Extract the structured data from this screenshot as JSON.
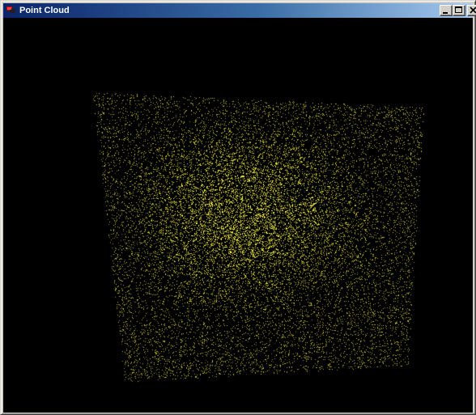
{
  "window": {
    "title": "Point Cloud",
    "icon": "app-icon",
    "controls": {
      "minimize": "minimize-icon",
      "maximize": "maximize-icon",
      "close": "close-icon"
    }
  },
  "viewport": {
    "background": "#000000",
    "point_color": "#e8e040",
    "highlight_color": "#ffff40"
  },
  "colors": {
    "titlebar_start": "#0a246a",
    "titlebar_end": "#a6caf0",
    "chrome": "#d4d0c8"
  }
}
